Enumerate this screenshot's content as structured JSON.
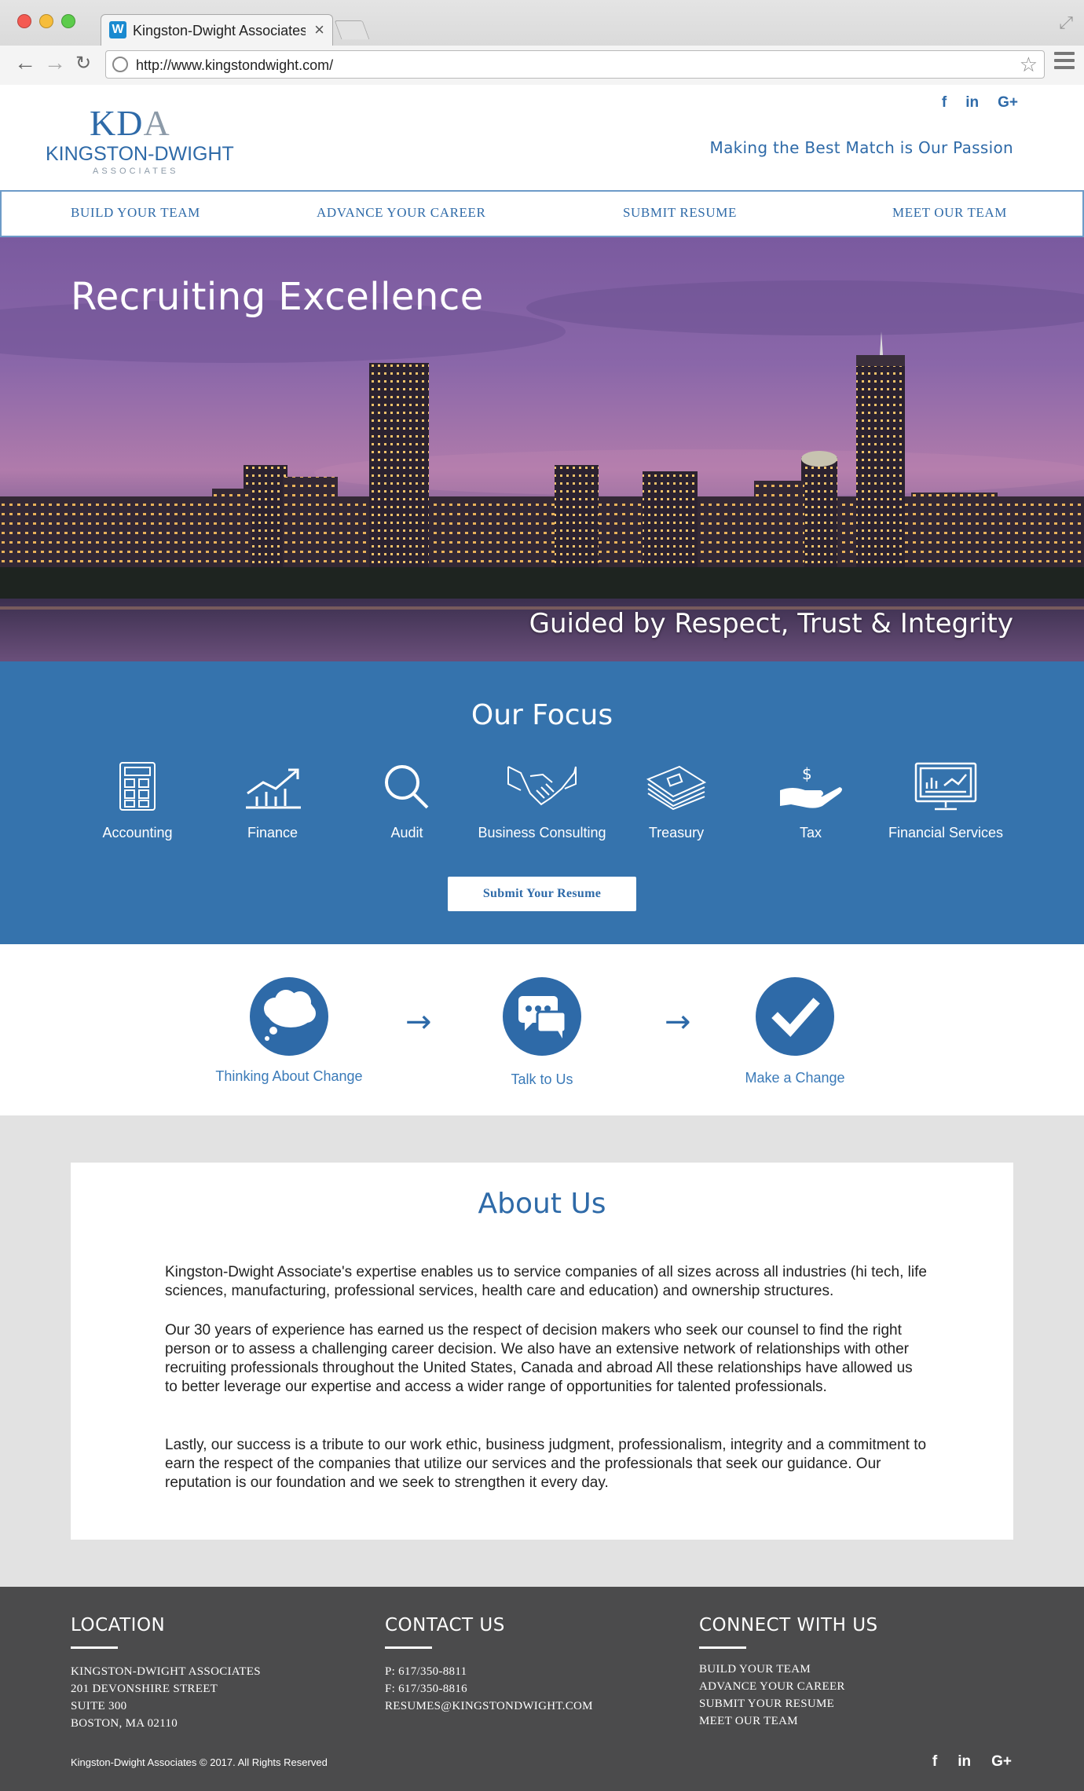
{
  "browser": {
    "tab_title": "Kingston-Dwight Associates",
    "favicon_letter": "W",
    "url": "http://www.kingstondwight.com/"
  },
  "header": {
    "logo_mark": "KD",
    "logo_mark_a": "A",
    "logo_name": "KINGSTON-DWIGHT",
    "logo_sub": "ASSOCIATES",
    "tagline": "Making the Best Match is Our Passion",
    "social": [
      "f",
      "in",
      "G+"
    ]
  },
  "nav": {
    "items": [
      "BUILD YOUR TEAM",
      "ADVANCE YOUR CAREER",
      "SUBMIT RESUME",
      "MEET OUR TEAM"
    ]
  },
  "hero": {
    "title": "Recruiting Excellence",
    "subtitle": "Guided by Respect, Trust & Integrity"
  },
  "focus": {
    "title": "Our Focus",
    "items": [
      {
        "label": "Accounting",
        "icon": "calculator-icon"
      },
      {
        "label": "Finance",
        "icon": "chart-icon"
      },
      {
        "label": "Audit",
        "icon": "magnifier-icon"
      },
      {
        "label": "Business Consulting",
        "icon": "handshake-icon"
      },
      {
        "label": "Treasury",
        "icon": "money-stack-icon"
      },
      {
        "label": "Tax",
        "icon": "hand-dollar-icon"
      },
      {
        "label": "Financial Services",
        "icon": "monitor-chart-icon"
      }
    ],
    "button": "Submit Your Resume"
  },
  "process": {
    "steps": [
      {
        "label": "Thinking About Change",
        "icon": "thought-bubble-icon"
      },
      {
        "label": "Talk to Us",
        "icon": "chat-icon"
      },
      {
        "label": "Make a Change",
        "icon": "checkmark-icon"
      }
    ],
    "arrow": "→"
  },
  "about": {
    "title": "About Us",
    "paragraphs": [
      "Kingston-Dwight Associate's expertise enables us to service companies of all sizes across all industries (hi tech, life sciences, manufacturing, professional services, health care and education) and ownership structures.",
      "Our 30 years of experience has earned us the respect of decision makers who seek  our counsel to find the right person or to assess a challenging career decision. We also  have an extensive network of relationships with other recruiting professionals throughout the United States, Canada and abroad  All these relationships have allowed us to better leverage our expertise and access a wider range of opportunities for talented professionals.",
      "Lastly, our success is a tribute to our work ethic, business judgment, professionalism, integrity and a commitment to earn the respect of the companies that utilize our services and the professionals that seek our guidance. Our reputation is our foundation and we seek to strengthen it every day."
    ]
  },
  "footer": {
    "location": {
      "heading": "LOCATION",
      "lines": [
        "KINGSTON-DWIGHT ASSOCIATES",
        "201 DEVONSHIRE STREET",
        "SUITE 300",
        "BOSTON, MA 02110"
      ]
    },
    "contact": {
      "heading": "CONTACT US",
      "lines": [
        "P: 617/350-8811",
        "F: 617/350-8816",
        "RESUMES@KINGSTONDWIGHT.COM"
      ]
    },
    "connect": {
      "heading": "CONNECT WITH US",
      "lines": [
        "BUILD YOUR TEAM",
        "ADVANCE YOUR CAREER",
        "SUBMIT YOUR RESUME",
        "MEET OUR TEAM"
      ]
    },
    "copyright": "Kingston-Dwight Associates © 2017. All Rights Reserved",
    "social": [
      "f",
      "in",
      "G+"
    ]
  },
  "colors": {
    "brand_blue": "#2e6aa8",
    "focus_bg": "#3573ad",
    "footer_bg": "#4b4b4c"
  }
}
